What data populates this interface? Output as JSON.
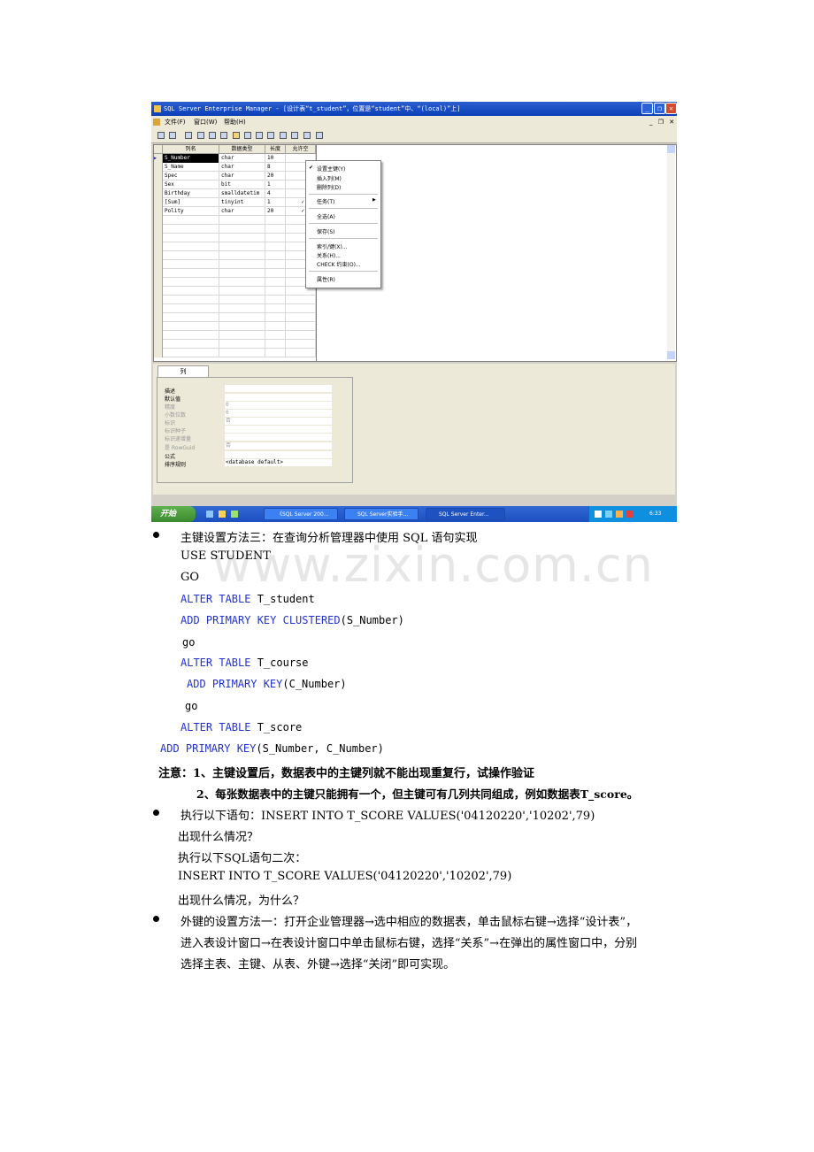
{
  "window": {
    "title": "SQL Server Enterprise Manager - [设计表“t_student”，位置是“student”中、“(local)”上]",
    "menu": [
      "文件(F)",
      "窗口(W)",
      "帮助(H)"
    ],
    "controls": {
      "minimize": "_",
      "restore": "❐",
      "close": "✕"
    },
    "mdi_controls": "_ ❐ ✕"
  },
  "grid": {
    "headers": [
      "列名",
      "数据类型",
      "长度",
      "允许空"
    ],
    "rows": [
      {
        "name": "S_Number",
        "type": "char",
        "length": "10",
        "nullable": "",
        "selected": true
      },
      {
        "name": "S_Name",
        "type": "char",
        "length": "8",
        "nullable": ""
      },
      {
        "name": "Spec",
        "type": "char",
        "length": "20",
        "nullable": ""
      },
      {
        "name": "Sex",
        "type": "bit",
        "length": "1",
        "nullable": ""
      },
      {
        "name": "Birthday",
        "type": "smalldatetim",
        "length": "4",
        "nullable": ""
      },
      {
        "name": "[Sum]",
        "type": "tinyint",
        "length": "1",
        "nullable": "✓"
      },
      {
        "name": "Polity",
        "type": "char",
        "length": "20",
        "nullable": "✓"
      }
    ]
  },
  "context_menu": {
    "items": [
      "设置主键(Y)",
      "插入列(M)",
      "删除列(D)",
      "任务(T)",
      "全选(A)",
      "保存(S)",
      "索引/键(X)...",
      "关系(H)...",
      "CHECK 约束(O)...",
      "属性(R)"
    ],
    "checked_index": 0
  },
  "properties": {
    "tab": "列",
    "labels": [
      "描述",
      "默认值",
      "精度",
      "小数位数",
      "标识",
      "标识种子",
      "标识递增量",
      "是 RowGuid",
      "公式",
      "排序规则"
    ],
    "values": [
      "",
      "",
      "0",
      "0",
      "否",
      "",
      "",
      "否",
      "",
      "<database default>"
    ]
  },
  "taskbar": {
    "start": "开始",
    "tasks": [
      "《SQL Server 200...",
      "SQL Server实验手...",
      "SQL Server Enter..."
    ],
    "time": "6:33"
  },
  "watermark": "www.zixin.com.cn",
  "doc": {
    "b1": "主键设置方法三：在查询分析管理器中使用 SQL 语句实现",
    "use": "USE STUDENT",
    "go1": "GO",
    "alter1_kw": "ALTER TABLE",
    "alter1_t": " T_student",
    "add1_kw": "ADD PRIMARY KEY CLUSTERED",
    "add1_t": "(S_Number)",
    "go2": "go",
    "alter2_kw": "ALTER TABLE",
    "alter2_t": " T_course",
    "add2_kw": "ADD PRIMARY KEY",
    "add2_t": "(C_Number)",
    "go3": "go",
    "alter3_kw": "ALTER TABLE",
    "alter3_t": " T_score",
    "add3_kw": "ADD PRIMARY KEY",
    "add3_t": "(S_Number, C_Number)",
    "note1": "注意：1、主键设置后，数据表中的主键列就不能出现重复行，试操作验证",
    "note2": "2、每张数据表中的主键只能拥有一个，但主键可有几列共同组成，例如数据表T_score。",
    "b2": "执行以下语句：INSERT INTO    T_SCORE    VALUES('04120220','10202',79)",
    "q1": "出现什么情况？",
    "p1": "执行以下SQL语句二次：",
    "ins": "INSERT INTO    T_SCORE    VALUES('04120220','10202',79)",
    "q2": "出现什么情况，为什么？",
    "b3_1": "外键的设置方法一：打开企业管理器→选中相应的数据表，单击鼠标右键→选择“设计表”，",
    "b3_2": "进入表设计窗口→在表设计窗口中单击鼠标右键，选择“关系”→在弹出的属性窗口中，分别",
    "b3_3": "选择主表、主键、从表、外键→选择“关闭”即可实现。"
  }
}
